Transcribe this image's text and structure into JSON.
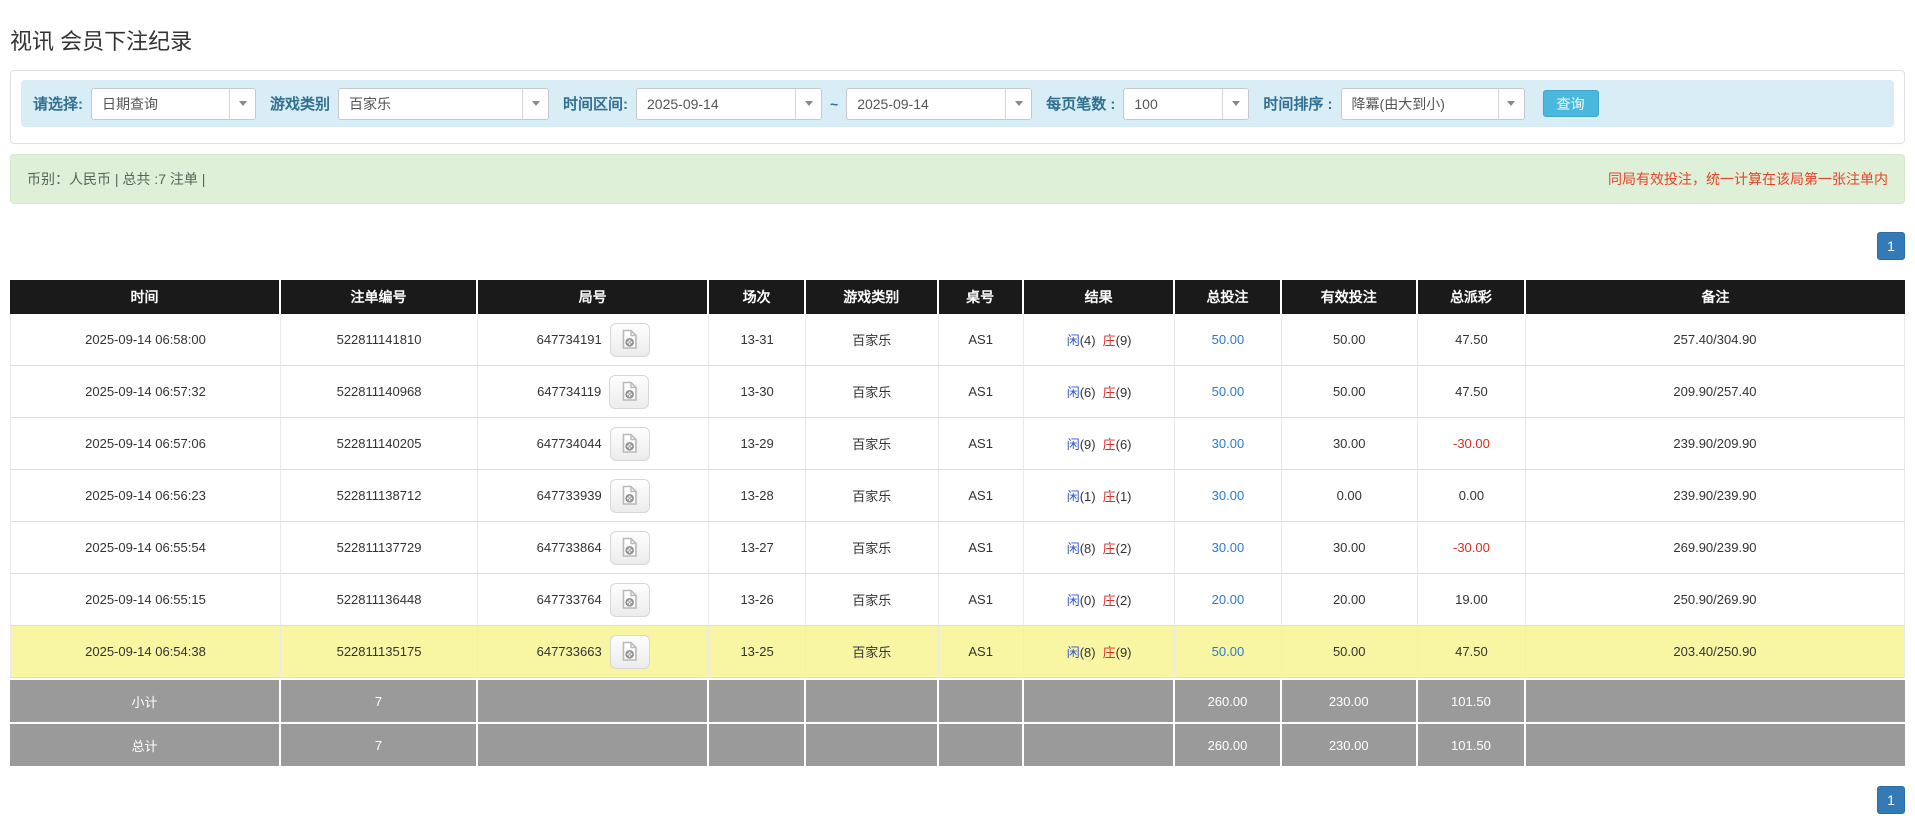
{
  "page": {
    "title": "视讯 会员下注纪录"
  },
  "filter": {
    "select_label": "请选择:",
    "select_value": "日期查询",
    "game_label": "游戏类别",
    "game_value": "百家乐",
    "range_label": "时间区间:",
    "date_from": "2025-09-14",
    "range_separator": "~",
    "date_to": "2025-09-14",
    "per_page_label": "每页笔数 :",
    "per_page_value": "100",
    "sort_label": "时间排序 :",
    "sort_value": "降冪(由大到小)",
    "search_button": "查询"
  },
  "summary": {
    "left_text": "币别：人民币 | 总共 :7 注单 |",
    "right_text": "同局有效投注，统一计算在该局第一张注单内"
  },
  "pagination": {
    "page": "1"
  },
  "table": {
    "headers": [
      "时间",
      "注单编号",
      "局号",
      "场次",
      "游戏类别",
      "桌号",
      "结果",
      "总投注",
      "有效投注",
      "总派彩",
      "备注"
    ],
    "result_labels": {
      "player": "闲",
      "banker": "庄"
    },
    "rows": [
      {
        "time": "2025-09-14 06:58:00",
        "bet_no": "522811141810",
        "round_no": "647734191",
        "session": "13-31",
        "game": "百家乐",
        "table_no": "AS1",
        "player": "(4)",
        "banker": "(9)",
        "total_bet": "50.00",
        "valid_bet": "50.00",
        "payout": "47.50",
        "note": "257.40/304.90",
        "highlight": false
      },
      {
        "time": "2025-09-14 06:57:32",
        "bet_no": "522811140968",
        "round_no": "647734119",
        "session": "13-30",
        "game": "百家乐",
        "table_no": "AS1",
        "player": "(6)",
        "banker": "(9)",
        "total_bet": "50.00",
        "valid_bet": "50.00",
        "payout": "47.50",
        "note": "209.90/257.40",
        "highlight": false
      },
      {
        "time": "2025-09-14 06:57:06",
        "bet_no": "522811140205",
        "round_no": "647734044",
        "session": "13-29",
        "game": "百家乐",
        "table_no": "AS1",
        "player": "(9)",
        "banker": "(6)",
        "total_bet": "30.00",
        "valid_bet": "30.00",
        "payout": "-30.00",
        "note": "239.90/209.90",
        "highlight": false
      },
      {
        "time": "2025-09-14 06:56:23",
        "bet_no": "522811138712",
        "round_no": "647733939",
        "session": "13-28",
        "game": "百家乐",
        "table_no": "AS1",
        "player": "(1)",
        "banker": "(1)",
        "total_bet": "30.00",
        "valid_bet": "0.00",
        "payout": "0.00",
        "note": "239.90/239.90",
        "highlight": false
      },
      {
        "time": "2025-09-14 06:55:54",
        "bet_no": "522811137729",
        "round_no": "647733864",
        "session": "13-27",
        "game": "百家乐",
        "table_no": "AS1",
        "player": "(8)",
        "banker": "(2)",
        "total_bet": "30.00",
        "valid_bet": "30.00",
        "payout": "-30.00",
        "note": "269.90/239.90",
        "highlight": false
      },
      {
        "time": "2025-09-14 06:55:15",
        "bet_no": "522811136448",
        "round_no": "647733764",
        "session": "13-26",
        "game": "百家乐",
        "table_no": "AS1",
        "player": "(0)",
        "banker": "(2)",
        "total_bet": "20.00",
        "valid_bet": "20.00",
        "payout": "19.00",
        "note": "250.90/269.90",
        "highlight": false
      },
      {
        "time": "2025-09-14 06:54:38",
        "bet_no": "522811135175",
        "round_no": "647733663",
        "session": "13-25",
        "game": "百家乐",
        "table_no": "AS1",
        "player": "(8)",
        "banker": "(9)",
        "total_bet": "50.00",
        "valid_bet": "50.00",
        "payout": "47.50",
        "note": "203.40/250.90",
        "highlight": true
      }
    ],
    "footer": [
      {
        "label": "小计",
        "count": "7",
        "total_bet": "260.00",
        "valid_bet": "230.00",
        "payout": "101.50"
      },
      {
        "label": "总计",
        "count": "7",
        "total_bet": "260.00",
        "valid_bet": "230.00",
        "payout": "101.50"
      }
    ]
  },
  "colors": {
    "filter_bar_bg": "#d9edf7",
    "filter_label": "#31708f",
    "search_button": "#49b8dc",
    "summary_bg": "#dff0d8",
    "summary_warning_red": "#e8432a",
    "pagination_blue": "#337ab7",
    "header_black": "#1a1a1a",
    "highlight_yellow": "#f9f6a3",
    "footer_gray": "#9a9a9a",
    "player_blue": "#3355cc",
    "banker_red": "#d9302c",
    "bet_link_blue": "#2a7ad2",
    "negative_red": "#e02b20"
  }
}
